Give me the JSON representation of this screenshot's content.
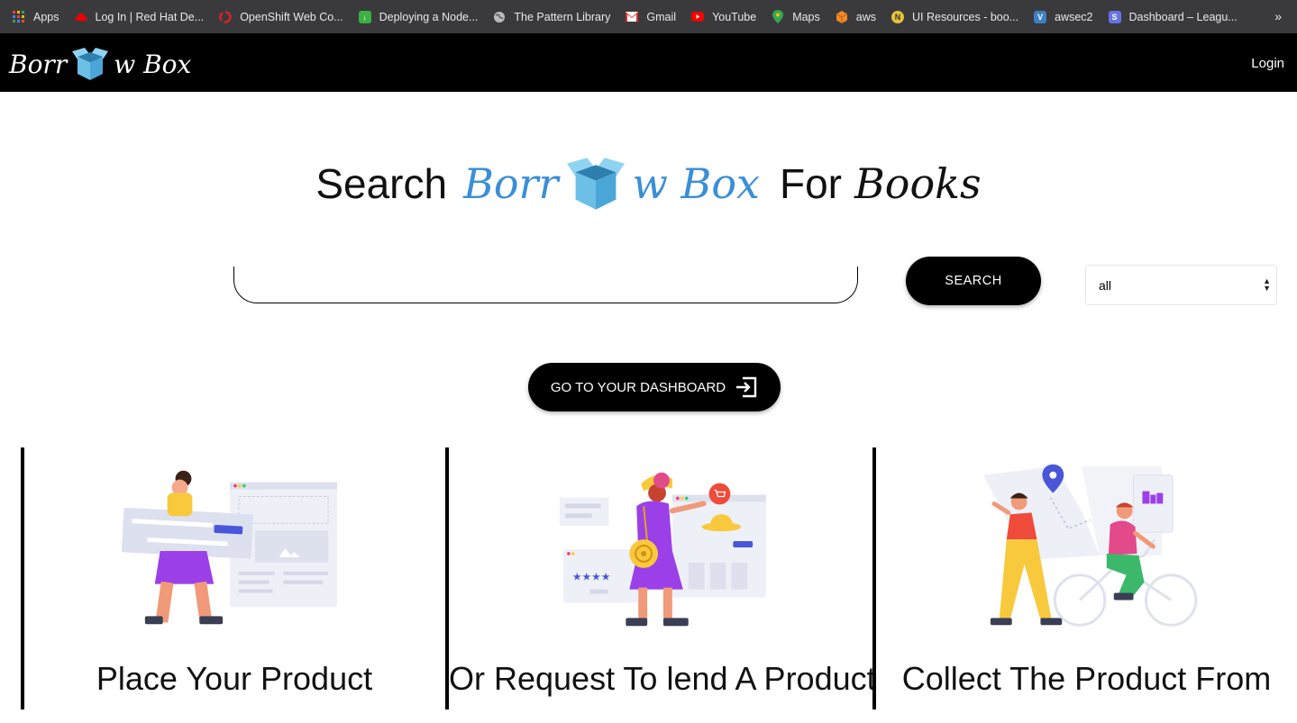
{
  "bookmarks": {
    "items": [
      {
        "label": "Apps",
        "icon": "apps-grid-icon",
        "color": "#e8453c"
      },
      {
        "label": "Log In | Red Hat De...",
        "icon": "redhat-icon",
        "color": "#ee0000"
      },
      {
        "label": "OpenShift Web Co...",
        "icon": "openshift-icon",
        "color": "#db212e"
      },
      {
        "label": "Deploying a Node...",
        "icon": "download-icon",
        "color": "#3cb043"
      },
      {
        "label": "The Pattern Library",
        "icon": "globe-icon",
        "color": "#888888"
      },
      {
        "label": "Gmail",
        "icon": "gmail-icon",
        "color": "#d93025"
      },
      {
        "label": "YouTube",
        "icon": "youtube-icon",
        "color": "#ff0000"
      },
      {
        "label": "Maps",
        "icon": "maps-pin-icon",
        "color": "#34a853"
      },
      {
        "label": "aws",
        "icon": "aws-cube-icon",
        "color": "#f08a24"
      },
      {
        "label": "UI Resources - boo...",
        "icon": "notion-icon",
        "color": "#e9c43a"
      },
      {
        "label": "awsec2",
        "icon": "vcard-icon",
        "color": "#3d7fc1"
      },
      {
        "label": "Dashboard – Leagu...",
        "icon": "stripe-s-icon",
        "color": "#6772e5"
      }
    ],
    "more": "»"
  },
  "navbar": {
    "logo_left": "Borr",
    "logo_right": "w Box",
    "login": "Login"
  },
  "hero": {
    "prefix": "Search",
    "brand_left": "Borr",
    "brand_right": "w Box",
    "suffix_a": "For",
    "suffix_b": "Books"
  },
  "search": {
    "value": "",
    "placeholder": "",
    "button": "SEARCH",
    "category": "all"
  },
  "dashboard_button": "GO TO YOUR DASHBOARD",
  "cards": [
    {
      "title": "Place Your Product"
    },
    {
      "title": "Or Request To lend A Product"
    },
    {
      "title": "Collect The Product From"
    }
  ],
  "colors": {
    "brand_blue": "#3a8fd6",
    "box_blue": "#6cc0e8",
    "button_black": "#000000"
  }
}
